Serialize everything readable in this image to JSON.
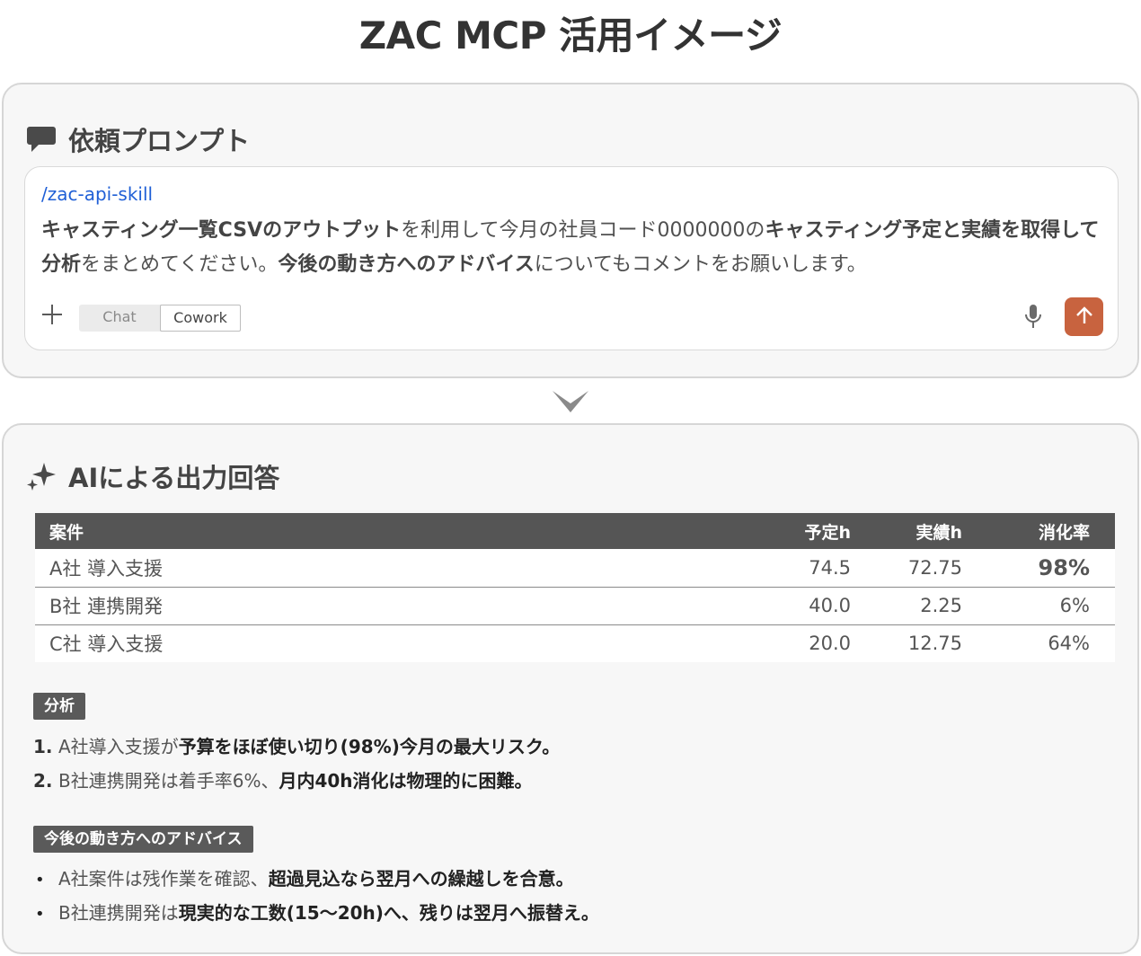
{
  "page": {
    "title": "ZAC MCP 活用イメージ"
  },
  "prompt_panel": {
    "header": "依頼プロンプト",
    "header_icon": "chat-bubble-icon",
    "slash_command": "/zac-api-skill",
    "prompt_segments": [
      {
        "text": "キャスティング一覧CSVのアウトプット",
        "bold": true
      },
      {
        "text": "を利用して今月の社員コード0000000の",
        "bold": false
      },
      {
        "text": "キャスティング予定と実績を取得して分析",
        "bold": true
      },
      {
        "text": "をまとめてください。",
        "bold": false
      },
      {
        "text": "今後の動き方へのアドバイス",
        "bold": true
      },
      {
        "text": "についてもコメントをお願いします。",
        "bold": false
      }
    ],
    "mode_options": [
      "Chat",
      "Cowork"
    ],
    "selected_mode": "Cowork",
    "icons": {
      "add": "plus-icon",
      "mic": "microphone-icon",
      "send": "arrow-up-icon"
    },
    "colors": {
      "send_button": "#c8633f",
      "slash_command": "#1f5fd6"
    }
  },
  "answer_panel": {
    "header": "AIによる出力回答",
    "header_icon": "sparkle-icon",
    "table": {
      "columns": [
        "案件",
        "予定h",
        "実績h",
        "消化率"
      ],
      "rows": [
        {
          "project": "A社 導入支援",
          "planned": "74.5",
          "actual": "72.75",
          "rate": "98%",
          "highlight": true
        },
        {
          "project": "B社 連携開発",
          "planned": "40.0",
          "actual": "2.25",
          "rate": "6%",
          "highlight": false
        },
        {
          "project": "C社 導入支援",
          "planned": "20.0",
          "actual": "12.75",
          "rate": "64%",
          "highlight": false
        }
      ]
    },
    "analysis": {
      "tag": "分析",
      "items": [
        {
          "marker": "1.",
          "plain": "A社導入支援が",
          "strong": "予算をほぼ使い切り(98%)今月の最大リスク。"
        },
        {
          "marker": "2.",
          "plain": "B社連携開発は着手率6%、",
          "strong": "月内40h消化は物理的に困難。"
        }
      ]
    },
    "advice": {
      "tag": "今後の動き方へのアドバイス",
      "items": [
        {
          "marker": "•",
          "plain": "A社案件は残作業を確認、",
          "strong": "超過見込なら翌月への繰越しを合意。"
        },
        {
          "marker": "•",
          "plain": "B社連携開発は",
          "strong": "現実的な工数(15〜20h)へ、残りは翌月へ振替え。"
        }
      ]
    }
  }
}
